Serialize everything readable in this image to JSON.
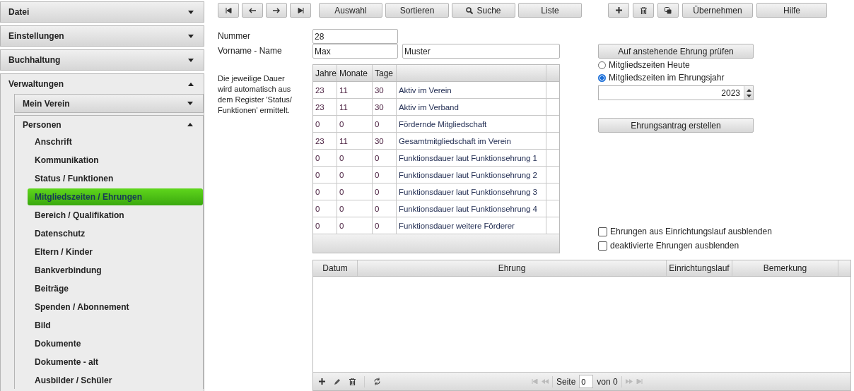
{
  "sidebar": {
    "sections": [
      {
        "label": "Datei",
        "expanded": false
      },
      {
        "label": "Einstellungen",
        "expanded": false
      },
      {
        "label": "Buchhaltung",
        "expanded": false
      },
      {
        "label": "Verwaltungen",
        "expanded": true,
        "children": [
          {
            "label": "Mein Verein",
            "expanded": false
          },
          {
            "label": "Personen",
            "expanded": true,
            "items": [
              {
                "label": "Anschrift",
                "selected": false
              },
              {
                "label": "Kommunikation",
                "selected": false
              },
              {
                "label": "Status / Funktionen",
                "selected": false
              },
              {
                "label": "Mitgliedszeiten / Ehrungen",
                "selected": true
              },
              {
                "label": "Bereich / Qualifikation",
                "selected": false
              },
              {
                "label": "Datenschutz",
                "selected": false
              },
              {
                "label": "Eltern / Kinder",
                "selected": false
              },
              {
                "label": "Bankverbindung",
                "selected": false
              },
              {
                "label": "Beiträge",
                "selected": false
              },
              {
                "label": "Spenden / Abonnement",
                "selected": false
              },
              {
                "label": "Bild",
                "selected": false
              },
              {
                "label": "Dokumente",
                "selected": false
              },
              {
                "label": "Dokumente - alt",
                "selected": false
              },
              {
                "label": "Ausbilder / Schüler",
                "selected": false
              }
            ]
          }
        ]
      }
    ]
  },
  "toolbar": {
    "buttons": [
      {
        "label": "Auswahl",
        "kind": "plain"
      },
      {
        "label": "Sortieren",
        "kind": "plain"
      },
      {
        "label": "Suche",
        "kind": "search"
      },
      {
        "label": "Liste",
        "kind": "plain"
      }
    ],
    "actions": [
      "Übernehmen",
      "Hilfe"
    ]
  },
  "form": {
    "number_label": "Nummer",
    "number": "28",
    "name_label": "Vorname - Name",
    "first_name": "Max",
    "last_name": "Muster",
    "note": "Die jeweilige Dauer wird automatisch aus dem Register 'Status/ Funktionen' ermittelt."
  },
  "durations": {
    "columns": [
      "Jahre",
      "Monate",
      "Tage"
    ],
    "rows": [
      {
        "years": "23",
        "months": "11",
        "days": "30",
        "label": "Aktiv im Verein"
      },
      {
        "years": "23",
        "months": "11",
        "days": "30",
        "label": "Aktiv im Verband"
      },
      {
        "years": "0",
        "months": "0",
        "days": "0",
        "label": "Fördernde Mitgliedschaft"
      },
      {
        "years": "23",
        "months": "11",
        "days": "30",
        "label": "Gesamtmitgliedschaft im Verein"
      },
      {
        "years": "0",
        "months": "0",
        "days": "0",
        "label": "Funktionsdauer laut Funktionsehrung 1"
      },
      {
        "years": "0",
        "months": "0",
        "days": "0",
        "label": "Funktionsdauer laut Funktionsehrung 2"
      },
      {
        "years": "0",
        "months": "0",
        "days": "0",
        "label": "Funktionsdauer laut Funktionsehrung 3"
      },
      {
        "years": "0",
        "months": "0",
        "days": "0",
        "label": "Funktionsdauer laut Funktionsehrung 4"
      },
      {
        "years": "0",
        "months": "0",
        "days": "0",
        "label": "Funktionsdauer weitere Förderer"
      }
    ]
  },
  "check_button": "Auf anstehende Ehrung prüfen",
  "radios": [
    {
      "label": "Mitgliedszeiten Heute",
      "selected": false
    },
    {
      "label": "Mitgliedszeiten im Ehrungsjahr",
      "selected": true
    }
  ],
  "year": "2023",
  "create_button": "Ehrungsantrag erstellen",
  "checkboxes": [
    {
      "label": "Ehrungen aus Einrichtungslauf ausblenden",
      "checked": false
    },
    {
      "label": "deaktivierte Ehrungen ausblenden",
      "checked": false
    }
  ],
  "honors": {
    "columns": [
      "Datum",
      "Ehrung",
      "Einrichtungslauf",
      "Bemerkung"
    ],
    "pager": {
      "page_label": "Seite",
      "page": "0",
      "of": "von 0"
    }
  }
}
